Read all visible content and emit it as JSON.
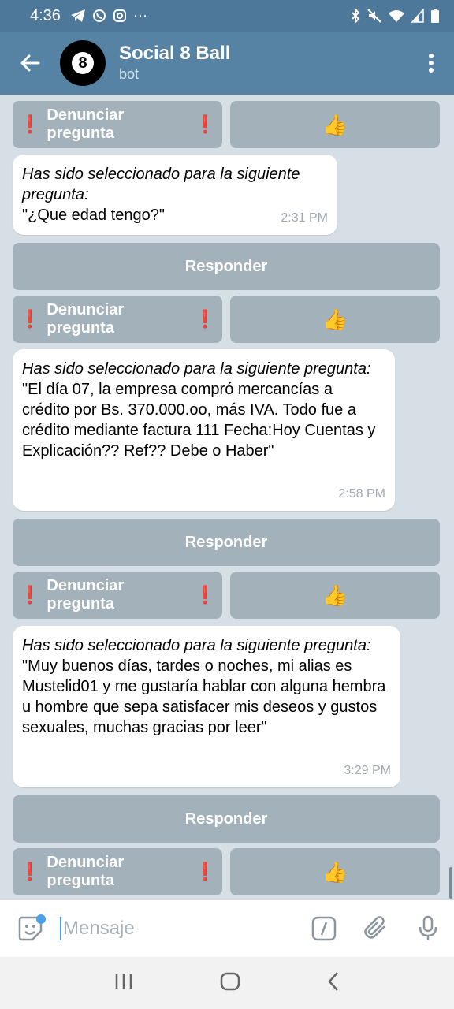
{
  "status": {
    "time": "4:36",
    "more": "⋯"
  },
  "header": {
    "title": "Social 8 Ball",
    "subtitle": "bot",
    "avatar_text": "8"
  },
  "buttons": {
    "report": "Denunciar pregunta",
    "answer": "Responder",
    "report_mark": "❗",
    "like": "👍"
  },
  "messages": [
    {
      "lead": "Has sido seleccionado para la siguiente pregunta:",
      "body": "\"¿Que edad tengo?\"",
      "time": "2:31 PM"
    },
    {
      "lead": "Has sido seleccionado para la siguiente pregunta:",
      "body": "\"El día 07, la empresa compró mercancías a crédito por Bs. 370.000.oo, más IVA. Todo fue a crédito mediante factura 111 Fecha:Hoy Cuentas y Explicación?? Ref?? Debe o  Haber\"",
      "time": "2:58 PM"
    },
    {
      "lead": "Has sido seleccionado para la siguiente pregunta:",
      "body": "\"Muy buenos días, tardes o noches, mi alias es Mustelid01 y me gustaría hablar con alguna hembra u hombre que sepa satisfacer mis deseos y gustos sexuales, muchas gracias por leer\"",
      "time": "3:29 PM"
    }
  ],
  "input": {
    "placeholder": "Mensaje"
  },
  "icons": {
    "back": "arrow-left-icon",
    "menu": "kebab-icon",
    "sticker": "sticker-icon",
    "command": "slash-command-icon",
    "attach": "paperclip-icon",
    "mic": "microphone-icon"
  },
  "colors": {
    "appbar": "#5682a3",
    "statusbar": "#4e7899",
    "chat_bg": "#d7dfe6",
    "accent": "#4aa1e8"
  }
}
